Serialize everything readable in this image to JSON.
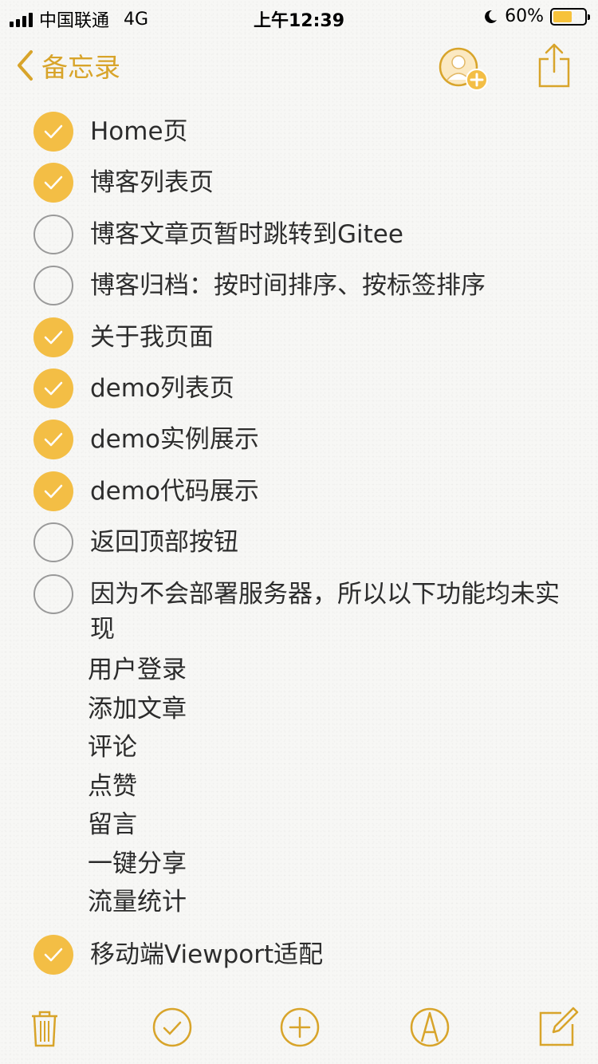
{
  "status_bar": {
    "carrier": "中国联通",
    "network": "4G",
    "time": "上午12:39",
    "battery": "60%",
    "battery_level": 0.6
  },
  "nav": {
    "back_label": "备忘录",
    "add_person_icon": "add-person-icon",
    "share_icon": "share-icon"
  },
  "checklist": [
    {
      "text": "Home页",
      "checked": true
    },
    {
      "text": "博客列表页",
      "checked": true
    },
    {
      "text": "博客文章页暂时跳转到Gitee",
      "checked": false
    },
    {
      "text": "博客归档：按时间排序、按标签排序",
      "checked": false
    },
    {
      "text": "关于我页面",
      "checked": true
    },
    {
      "text": "demo列表页",
      "checked": true
    },
    {
      "text": "demo实例展示",
      "checked": true
    },
    {
      "text": "demo代码展示",
      "checked": true
    },
    {
      "text": "返回顶部按钮",
      "checked": false
    },
    {
      "text": "因为不会部署服务器，所以以下功能均未实现",
      "checked": false
    }
  ],
  "plain_lines": [
    "用户登录",
    "添加文章",
    "评论",
    "点赞",
    "留言",
    "一键分享",
    "流量统计"
  ],
  "last_item": {
    "text": "移动端Viewport适配",
    "checked": true
  },
  "toolbar": {
    "icons": [
      "trash-icon",
      "checklist-icon",
      "add-icon",
      "markup-icon",
      "compose-icon"
    ]
  },
  "colors": {
    "accent": "#d8a42a",
    "check_fill": "#f3be45"
  }
}
